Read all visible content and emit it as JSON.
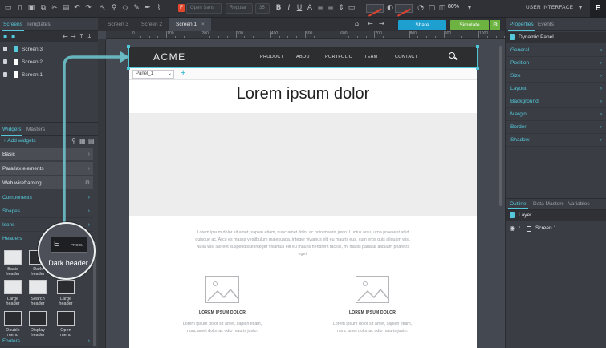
{
  "toolbar": {
    "font_name": "Open Sans",
    "font_style": "Regular",
    "font_size": "35",
    "zoom": "80%",
    "ui_label": "USER INTERFACE",
    "ui_badge": "E",
    "font_badge": "F"
  },
  "left_panel": {
    "tabs": [
      "Screens",
      "Templates"
    ],
    "screens": [
      {
        "label": "Screen 3",
        "selected": true
      },
      {
        "label": "Screen 2",
        "selected": false
      },
      {
        "label": "Screen 1",
        "selected": false
      }
    ]
  },
  "widgets_panel": {
    "tabs": [
      "Widgets",
      "Masters"
    ],
    "add_label": "Add widgets",
    "libraries": [
      "Basic",
      "Parallax elements",
      "Web wireframing"
    ],
    "categories": [
      "Components",
      "Shapes",
      "Icons",
      "Headers",
      "Footers"
    ],
    "thumbnails": [
      "Basic header",
      "Dark header",
      "Large header",
      "Search header",
      "Large header",
      "Double menu",
      "Display header",
      "Open menu"
    ]
  },
  "magnifier": {
    "label": "Dark header",
    "thumb_left": "E",
    "thumb_right": "PRODU"
  },
  "doc_tabs": [
    "Screen 3",
    "Screen 2",
    "Screen 1"
  ],
  "actions": {
    "share": "Share",
    "simulate": "Simulate"
  },
  "ruler": {
    "marks": [
      "0",
      "100",
      "200",
      "300",
      "400",
      "500",
      "600",
      "700",
      "800",
      "900",
      "1000"
    ]
  },
  "page": {
    "logo": "ACME",
    "nav": [
      "PRODUCT",
      "ABOUT",
      "PORTFOLIO",
      "TEAM",
      "CONTACT"
    ],
    "panel_select": "Panel_1",
    "hero_title": "Lorem ipsum dolor",
    "lorem": "Lorem ipsum dolor sit amet, sapien etiam, nunc amet dolor ac odio mauris justo. Luctus arcu, urna praesent at id quisque ac. Arcu es massa vestibulum malesuada, integer vivamus elit eu mauris eus, cum eros quis aliquam wisi. Nulla wisi laoreet suspendisse integer vivamus elit eu mauris hendrerit facilisi, mi mattis pariatur aliquam pharetra eget.",
    "columns": [
      {
        "title": "LOREM IPSUM DOLOR",
        "text": "Lorem ipsum dolor sit amet, sapien etiam, nunc amet dolor ac odio mauris justo."
      },
      {
        "title": "LOREM IPSUM DOLOR",
        "text": "Lorem ipsum dolor sit amet, sapien etiam, nunc amet dolor ac odio mauris justo."
      }
    ]
  },
  "right_panel": {
    "tabs": [
      "Properties",
      "Events"
    ],
    "selected": "Dynamic Panel",
    "properties": [
      "General",
      "Position",
      "Size",
      "Layout",
      "Background",
      "Margin",
      "Border",
      "Shadow"
    ]
  },
  "outline_panel": {
    "tabs": [
      "Outline",
      "Data Masters",
      "Variables"
    ],
    "layer_header": "Layer",
    "items": [
      "Screen 1"
    ]
  },
  "colors": {
    "accent": "#55c8dc",
    "share": "#1d9fd0",
    "simulate": "#6db342",
    "header": "#2d2e30"
  }
}
